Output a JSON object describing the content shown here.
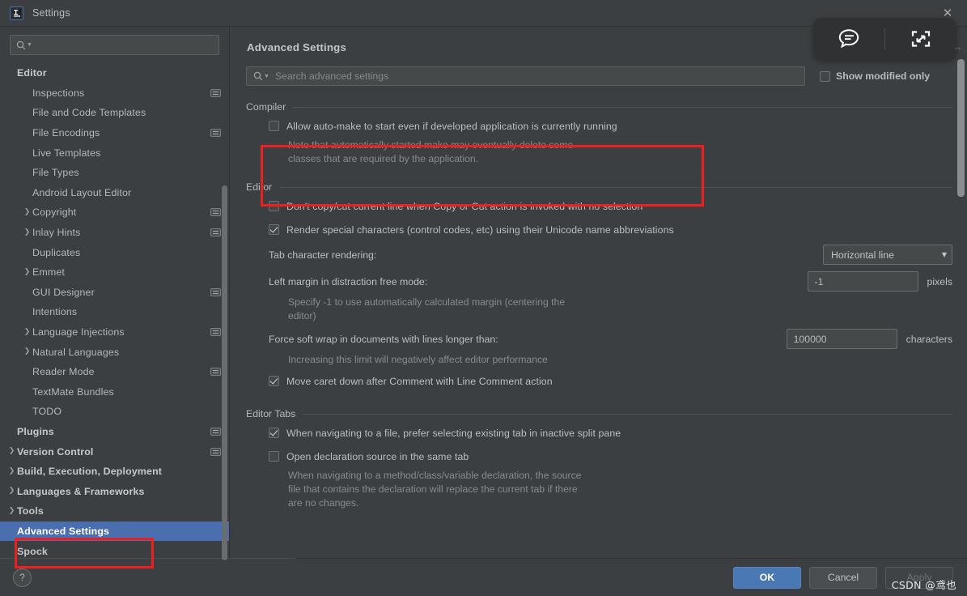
{
  "window": {
    "title": "Settings",
    "logo_icon": "intellij-idea-logo-icon",
    "close_icon": "close-icon"
  },
  "float_widget": {
    "comment_icon": "comment-bubble-icon",
    "expand_icon": "expand-fullscreen-icon",
    "arrow_icon": "arrow-right-icon"
  },
  "sidebar": {
    "search": {
      "placeholder": "",
      "value": "",
      "icon": "search-icon"
    },
    "scrollbar": "sidebar-scrollbar",
    "tree": [
      {
        "label": "Editor",
        "indent": 0,
        "bold": true,
        "arrow": "",
        "badge": false,
        "selected": false
      },
      {
        "label": "Inspections",
        "indent": 1,
        "bold": false,
        "arrow": "",
        "badge": true,
        "selected": false
      },
      {
        "label": "File and Code Templates",
        "indent": 1,
        "bold": false,
        "arrow": "",
        "badge": false,
        "selected": false
      },
      {
        "label": "File Encodings",
        "indent": 1,
        "bold": false,
        "arrow": "",
        "badge": true,
        "selected": false
      },
      {
        "label": "Live Templates",
        "indent": 1,
        "bold": false,
        "arrow": "",
        "badge": false,
        "selected": false
      },
      {
        "label": "File Types",
        "indent": 1,
        "bold": false,
        "arrow": "",
        "badge": false,
        "selected": false
      },
      {
        "label": "Android Layout Editor",
        "indent": 1,
        "bold": false,
        "arrow": "",
        "badge": false,
        "selected": false
      },
      {
        "label": "Copyright",
        "indent": 1,
        "bold": false,
        "arrow": "›",
        "badge": true,
        "selected": false
      },
      {
        "label": "Inlay Hints",
        "indent": 1,
        "bold": false,
        "arrow": "›",
        "badge": true,
        "selected": false
      },
      {
        "label": "Duplicates",
        "indent": 1,
        "bold": false,
        "arrow": "",
        "badge": false,
        "selected": false
      },
      {
        "label": "Emmet",
        "indent": 1,
        "bold": false,
        "arrow": "›",
        "badge": false,
        "selected": false
      },
      {
        "label": "GUI Designer",
        "indent": 1,
        "bold": false,
        "arrow": "",
        "badge": true,
        "selected": false
      },
      {
        "label": "Intentions",
        "indent": 1,
        "bold": false,
        "arrow": "",
        "badge": false,
        "selected": false
      },
      {
        "label": "Language Injections",
        "indent": 1,
        "bold": false,
        "arrow": "›",
        "badge": true,
        "selected": false
      },
      {
        "label": "Natural Languages",
        "indent": 1,
        "bold": false,
        "arrow": "›",
        "badge": false,
        "selected": false
      },
      {
        "label": "Reader Mode",
        "indent": 1,
        "bold": false,
        "arrow": "",
        "badge": true,
        "selected": false
      },
      {
        "label": "TextMate Bundles",
        "indent": 1,
        "bold": false,
        "arrow": "",
        "badge": false,
        "selected": false
      },
      {
        "label": "TODO",
        "indent": 1,
        "bold": false,
        "arrow": "",
        "badge": false,
        "selected": false
      },
      {
        "label": "Plugins",
        "indent": 0,
        "bold": true,
        "arrow": "",
        "badge": true,
        "selected": false
      },
      {
        "label": "Version Control",
        "indent": 0,
        "bold": true,
        "arrow": "›",
        "badge": true,
        "selected": false
      },
      {
        "label": "Build, Execution, Deployment",
        "indent": 0,
        "bold": true,
        "arrow": "›",
        "badge": false,
        "selected": false
      },
      {
        "label": "Languages & Frameworks",
        "indent": 0,
        "bold": true,
        "arrow": "›",
        "badge": false,
        "selected": false
      },
      {
        "label": "Tools",
        "indent": 0,
        "bold": true,
        "arrow": "›",
        "badge": false,
        "selected": false
      },
      {
        "label": "Advanced Settings",
        "indent": 0,
        "bold": true,
        "arrow": "",
        "badge": false,
        "selected": true
      },
      {
        "label": "Spock",
        "indent": 0,
        "bold": true,
        "arrow": "",
        "badge": false,
        "selected": false
      }
    ]
  },
  "content": {
    "page_title": "Advanced Settings",
    "search": {
      "placeholder": "Search advanced settings",
      "value": "",
      "icon": "search-icon"
    },
    "show_modified_only": {
      "label": "Show modified only",
      "checked": false
    },
    "sections": [
      {
        "name": "Compiler",
        "rows": [
          {
            "kind": "checkbox",
            "label": "Allow auto-make to start even if developed application is currently running",
            "checked": false,
            "dim": false,
            "note": "Note that automatically started make may eventually delete some\nclasses that are required by the application."
          }
        ]
      },
      {
        "name": "Editor",
        "rows": [
          {
            "kind": "checkbox",
            "label": "Don't copy/cut current line when Copy or Cut action is invoked with no selection",
            "checked": false,
            "dim": false,
            "note": ""
          },
          {
            "kind": "checkbox",
            "label": "Render special characters (control codes, etc) using their Unicode name abbreviations",
            "checked": true,
            "dim": false,
            "note": ""
          },
          {
            "kind": "combo",
            "label": "Tab character rendering:",
            "value": "Horizontal line",
            "unit": "",
            "dim": false,
            "note": ""
          },
          {
            "kind": "field",
            "label": "Left margin in distraction free mode:",
            "value": "-1",
            "unit": "pixels",
            "dim": false,
            "note": "Specify -1 to use automatically calculated margin (centering the\neditor)"
          },
          {
            "kind": "field",
            "label": "Force soft wrap in documents with lines longer than:",
            "value": "100000",
            "unit": "characters",
            "dim": false,
            "note": "Increasing this limit will negatively affect editor performance"
          },
          {
            "kind": "checkbox",
            "label": "Move caret down after Comment with Line Comment action",
            "checked": true,
            "dim": false,
            "note": ""
          }
        ]
      },
      {
        "name": "Editor Tabs",
        "rows": [
          {
            "kind": "checkbox",
            "label": "When navigating to a file, prefer selecting existing tab in inactive split pane",
            "checked": true,
            "dim": false,
            "note": ""
          },
          {
            "kind": "checkbox",
            "label": "Open declaration source in the same tab",
            "checked": false,
            "dim": false,
            "note": "When navigating to a method/class/variable declaration, the source\nfile that contains the declaration will replace the current tab if there\nare no changes."
          }
        ]
      }
    ],
    "scrollbar": "content-scrollbar"
  },
  "footer": {
    "help_label": "?",
    "ok_label": "OK",
    "cancel_label": "Cancel",
    "apply_label": "Apply",
    "apply_disabled": true
  },
  "watermark": "CSDN @鸢也",
  "colors": {
    "background": "#3c3f41",
    "selection_blue": "#4b6eaf",
    "highlight_red": "#f01f1f",
    "primary_button": "#4a78b4",
    "field_background": "#45494a"
  }
}
